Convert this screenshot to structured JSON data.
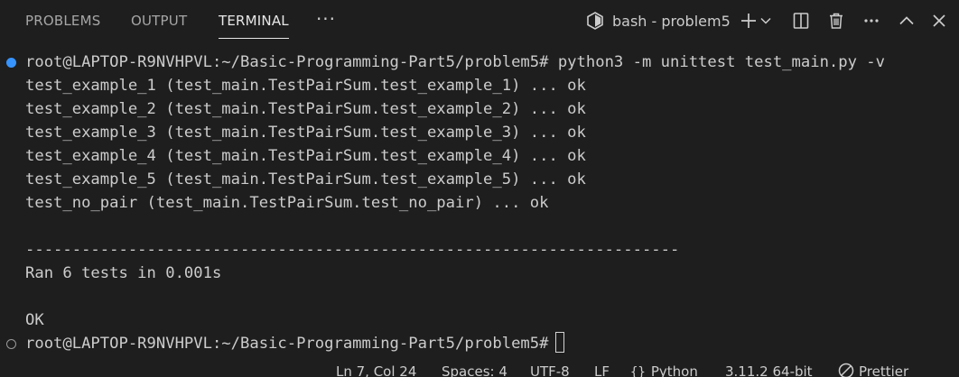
{
  "panel": {
    "tabs": [
      {
        "label": "PROBLEMS"
      },
      {
        "label": "OUTPUT"
      },
      {
        "label": "TERMINAL",
        "active": true
      }
    ],
    "more_glyph": "···",
    "terminal_selector": "bash - problem5",
    "actions": [
      "plus-icon",
      "chevron-down-icon",
      "split-icon",
      "trash-icon",
      "ellipsis-icon",
      "chevron-up-icon",
      "close-icon"
    ]
  },
  "terminal": {
    "prompt": "root@LAPTOP-R9NVHPVL:~/Basic-Programming-Part5/problem5#",
    "command": " python3 -m unittest test_main.py -v",
    "lines": [
      "test_example_1 (test_main.TestPairSum.test_example_1) ... ok",
      "test_example_2 (test_main.TestPairSum.test_example_2) ... ok",
      "test_example_3 (test_main.TestPairSum.test_example_3) ... ok",
      "test_example_4 (test_main.TestPairSum.test_example_4) ... ok",
      "test_example_5 (test_main.TestPairSum.test_example_5) ... ok",
      "test_no_pair (test_main.TestPairSum.test_no_pair) ... ok",
      "",
      "----------------------------------------------------------------------",
      "Ran 6 tests in 0.001s",
      "",
      "OK"
    ],
    "final_prompt": "root@LAPTOP-R9NVHPVL:~/Basic-Programming-Part5/problem5#",
    "decoration_colors": {
      "success": "#3794ff",
      "default": "#9a9a9a"
    }
  },
  "status_bar": {
    "position": "Ln 7, Col 24",
    "spaces": "Spaces: 4",
    "encoding": "UTF-8",
    "eol": "LF",
    "language": "Python",
    "interpreter": "3.11.2 64-bit",
    "formatter": "Prettier"
  }
}
